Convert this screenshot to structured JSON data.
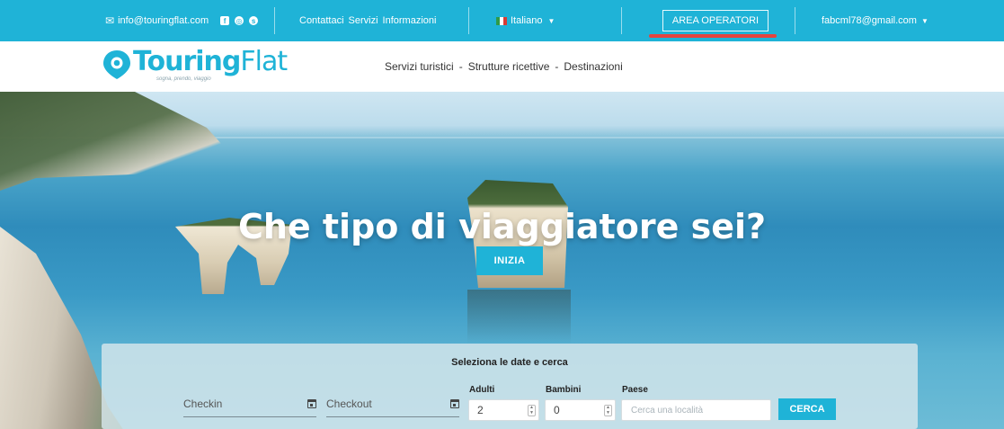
{
  "topbar": {
    "email": "info@touringflat.com",
    "links": [
      "Contattaci",
      "Servizi",
      "Informazioni"
    ],
    "language": "Italiano",
    "area_operatori": "AREA OPERATORI",
    "user_email": "fabcml78@gmail.com",
    "bg_color": "#1fb3d7",
    "accent_underline": "#e5443f"
  },
  "header": {
    "logo_bold": "Touring",
    "logo_light": "Flat",
    "logo_tagline": "sogna, prendo, viaggio",
    "nav": [
      "Servizi turistici",
      "Strutture ricettive",
      "Destinazioni"
    ],
    "nav_separator": "-"
  },
  "hero": {
    "title": "Che tipo di viaggiatore sei?",
    "cta": "INIZIA"
  },
  "search": {
    "title": "Seleziona le date e cerca",
    "checkin_label": "Checkin",
    "checkout_label": "Checkout",
    "adulti_label": "Adulti",
    "adulti_value": "2",
    "bambini_label": "Bambini",
    "bambini_value": "0",
    "paese_label": "Paese",
    "paese_placeholder": "Cerca una località",
    "submit": "CERCA"
  }
}
